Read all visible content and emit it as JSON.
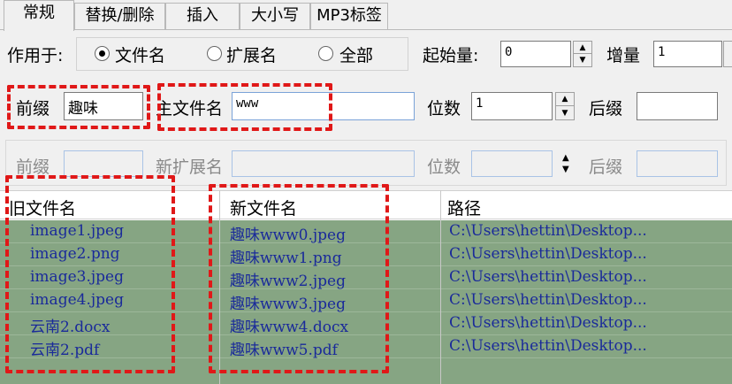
{
  "tabs": [
    {
      "label": "常规",
      "active": true
    },
    {
      "label": "替换/删除",
      "active": false
    },
    {
      "label": "插入",
      "active": false
    },
    {
      "label": "大小写",
      "active": false
    },
    {
      "label": "MP3标签",
      "active": false
    }
  ],
  "apply_to": {
    "label": "作用于:",
    "options": [
      "文件名",
      "扩展名",
      "全部"
    ],
    "selected": "文件名"
  },
  "start": {
    "label": "起始量:",
    "value": "0"
  },
  "increment": {
    "label": "增量",
    "value": "1"
  },
  "name_row": {
    "prefix_label": "前缀",
    "prefix_value": "趣味",
    "main_label": "主文件名",
    "main_value": "www",
    "digits_label": "位数",
    "digits_value": "1",
    "suffix_label": "后缀",
    "suffix_value": ""
  },
  "ext_row": {
    "prefix_label": "前缀",
    "new_ext_label": "新扩展名",
    "digits_label": "位数",
    "suffix_label": "后缀"
  },
  "table": {
    "columns": [
      "旧文件名",
      "新文件名",
      "路径"
    ],
    "rows": [
      {
        "old": "image1.jpeg",
        "new": "趣味www0.jpeg",
        "path": "C:\\Users\\hettin\\Desktop..."
      },
      {
        "old": "image2.png",
        "new": "趣味www1.png",
        "path": "C:\\Users\\hettin\\Desktop..."
      },
      {
        "old": "image3.jpeg",
        "new": "趣味www2.jpeg",
        "path": "C:\\Users\\hettin\\Desktop..."
      },
      {
        "old": "image4.jpeg",
        "new": "趣味www3.jpeg",
        "path": "C:\\Users\\hettin\\Desktop..."
      },
      {
        "old": "云南2.docx",
        "new": "趣味www4.docx",
        "path": "C:\\Users\\hettin\\Desktop..."
      },
      {
        "old": "云南2.pdf",
        "new": "趣味www5.pdf",
        "path": "C:\\Users\\hettin\\Desktop..."
      }
    ]
  },
  "colors": {
    "row_bg": "#86a583",
    "row_text": "#1a2a9a",
    "highlight": "#e01818"
  }
}
